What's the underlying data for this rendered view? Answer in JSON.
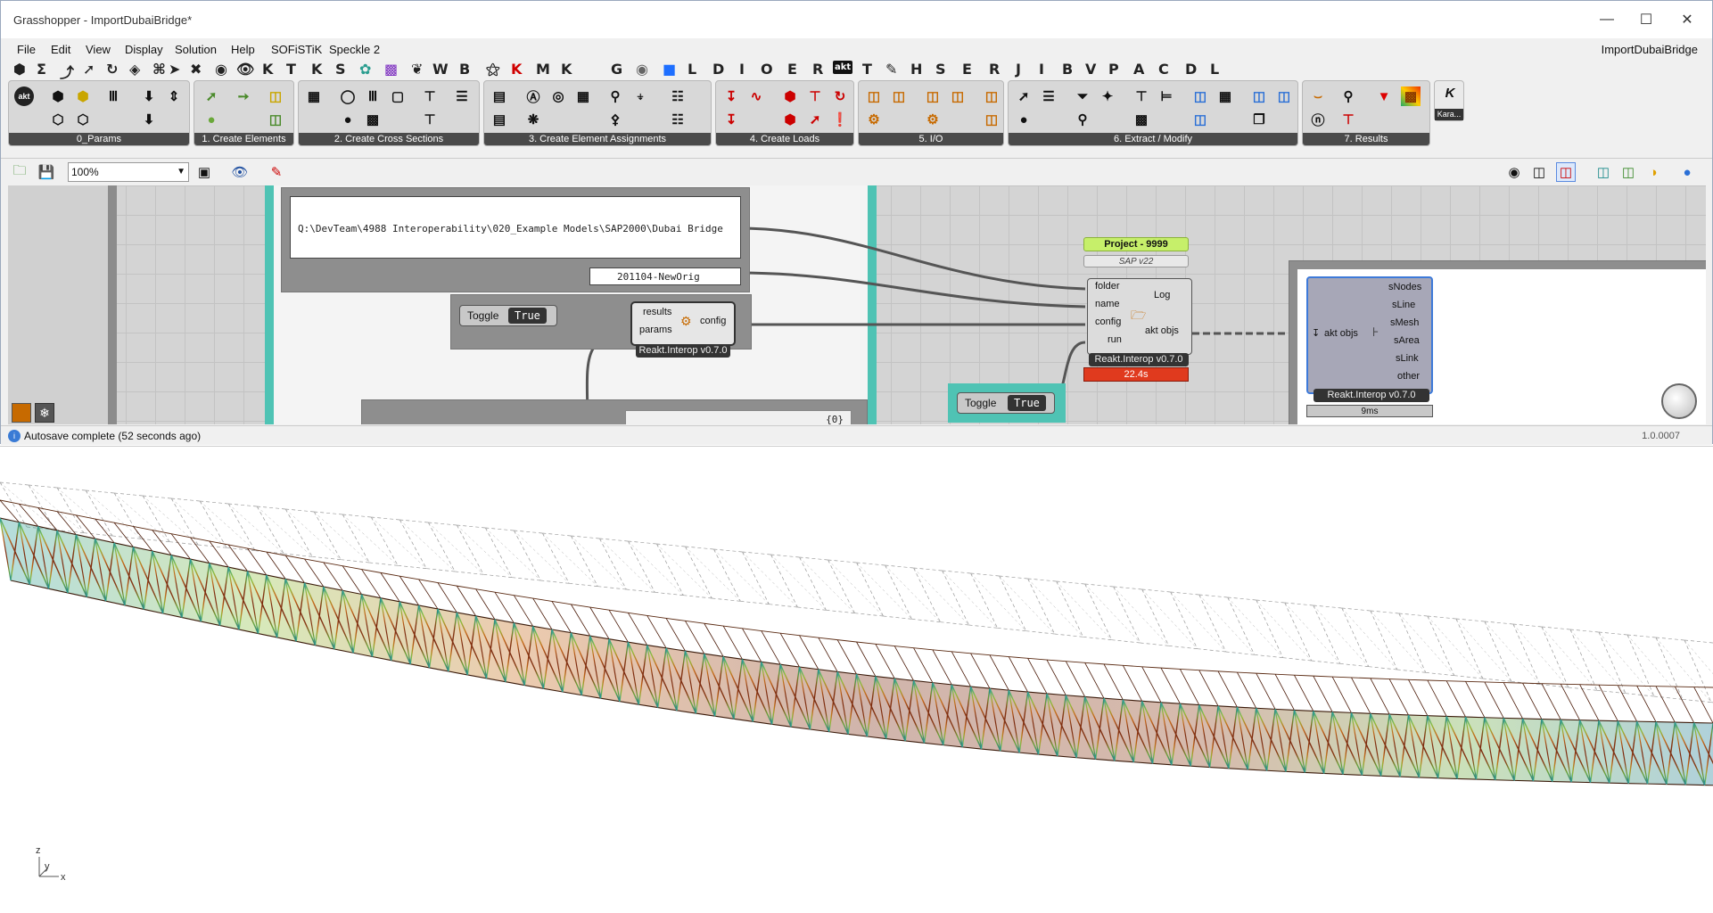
{
  "window": {
    "title": "Grasshopper - ImportDubaiBridge*",
    "document_name": "ImportDubaiBridge"
  },
  "menu": [
    "File",
    "Edit",
    "View",
    "Display",
    "Solution",
    "Help",
    "SOFiSTiK",
    "Speckle 2"
  ],
  "component_tabs": [
    "K",
    "T",
    "K",
    "S",
    "W",
    "B",
    "K",
    "M",
    "K",
    "G",
    "L",
    "D",
    "I",
    "O",
    "E",
    "R",
    "akt",
    "T",
    "H",
    "S",
    "E",
    "R",
    "J",
    "I",
    "B",
    "V",
    "P",
    "A",
    "C",
    "D",
    "L"
  ],
  "ribbon_groups": [
    "0_Params",
    "1. Create Elements",
    "2. Create Cross Sections",
    "3. Create Element Assignments",
    "4. Create Loads",
    "5. I/O",
    "6. Extract / Modify",
    "7. Results"
  ],
  "ribbon_extra_label": "Kara...",
  "ribbon_akt_label": "akt",
  "canvas_toolbar": {
    "zoom": "100%"
  },
  "canvas": {
    "path_panel": "Q:\\DevTeam\\4988 Interoperability\\020_Example Models\\SAP2000\\Dubai Bridge",
    "name_panel": "201104-NewOrig",
    "toggle1": {
      "label": "Toggle",
      "value": "True"
    },
    "toggle2": {
      "label": "Toggle",
      "value": "True"
    },
    "config_comp": {
      "inputs": [
        "results",
        "params"
      ],
      "output": "config",
      "label": "Reakt.Interop v0.7.0"
    },
    "project_tag": "Project - 9999",
    "sap_tag": "SAP v22",
    "import_comp": {
      "inputs": [
        "folder",
        "name",
        "config",
        "run"
      ],
      "outputs": [
        "Log",
        "akt objs"
      ],
      "label": "Reakt.Interop v0.7.0",
      "time": "22.4s"
    },
    "deconstruct_comp": {
      "input": "akt objs",
      "outputs": [
        "sNodes",
        "sLine",
        "sMesh",
        "sArea",
        "sLink",
        "other"
      ],
      "label": "Reakt.Interop v0.7.0",
      "time": "9ms"
    },
    "list_panel": "{0}"
  },
  "status": {
    "text": "Autosave complete (52 seconds ago)",
    "version": "1.0.0007"
  },
  "viewport": {
    "axes": [
      "z",
      "y",
      "x"
    ]
  }
}
